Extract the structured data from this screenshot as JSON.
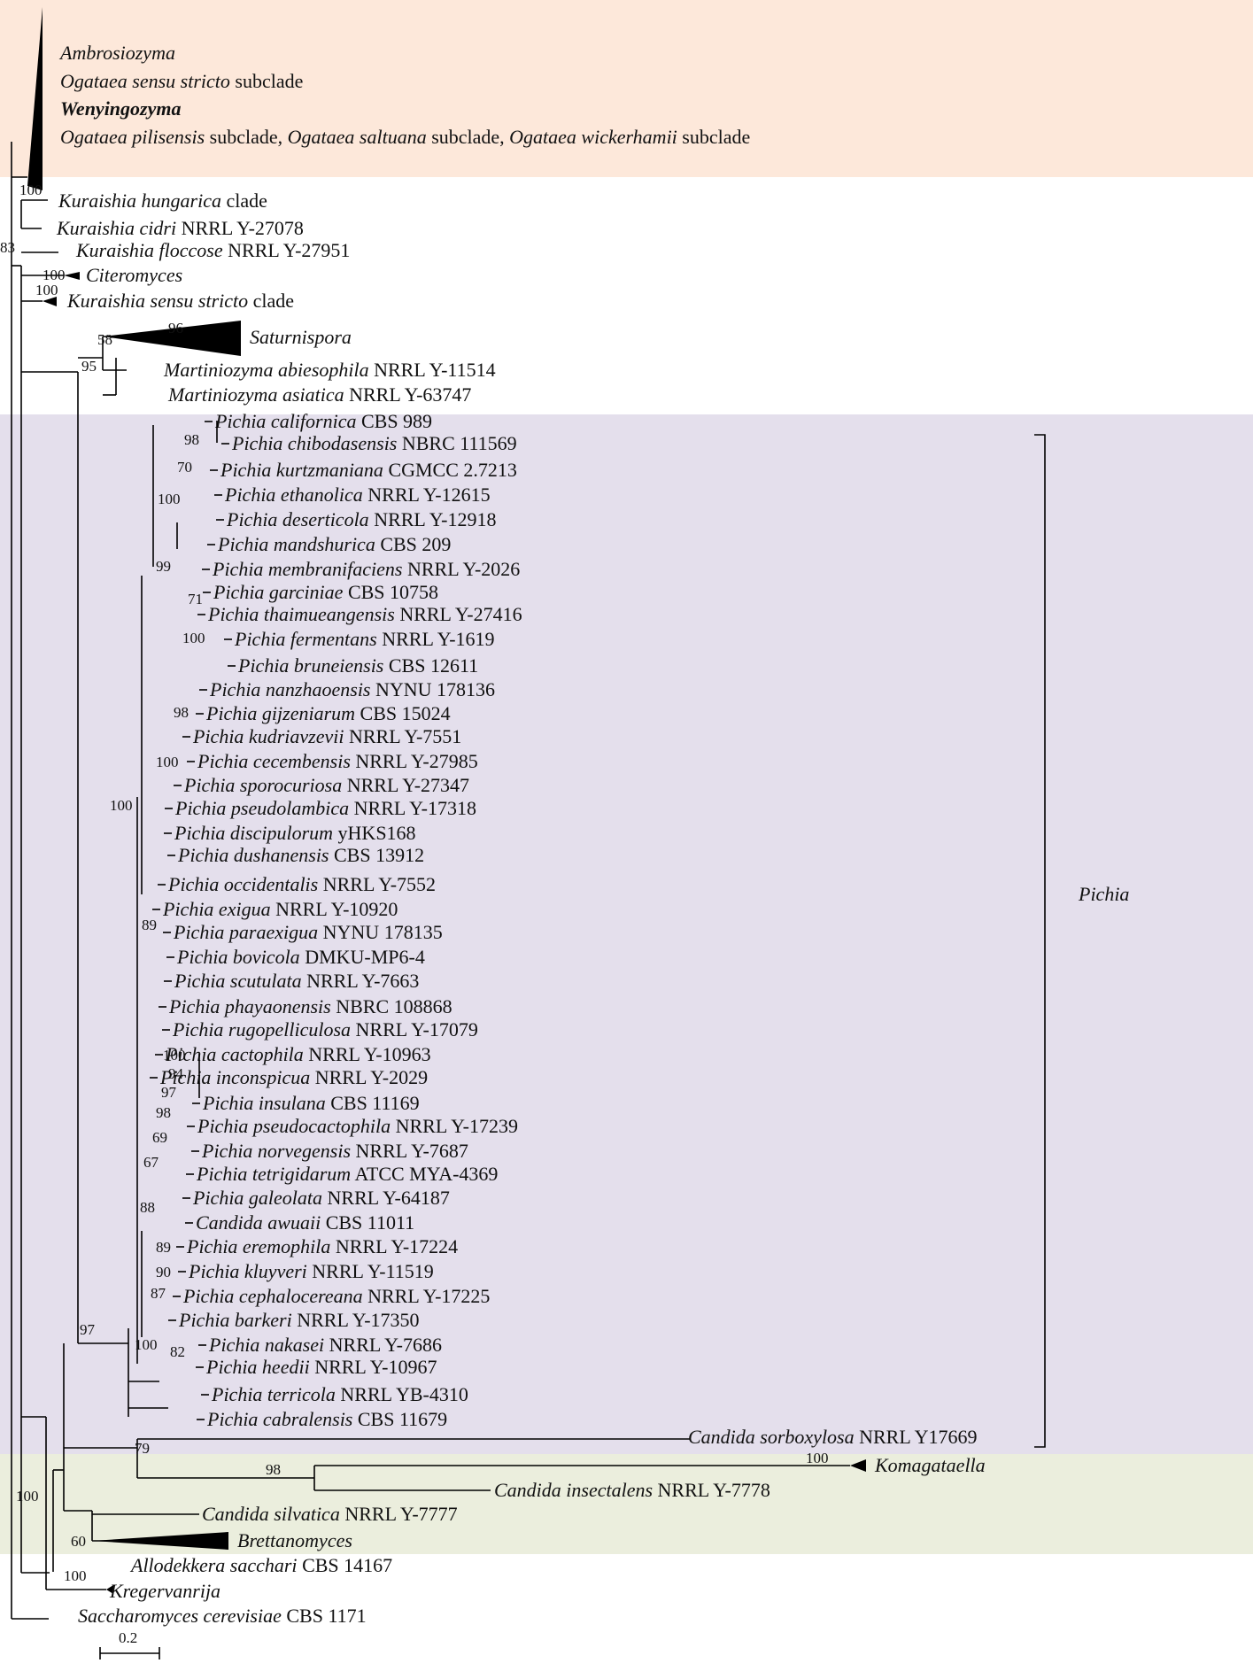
{
  "colors": {
    "band_top": "#fde8da",
    "band_mid": "#e4dfec",
    "band_bottom": "#ebeedd",
    "line": "#000000"
  },
  "header_clade": [
    [
      [
        "Ambrosiozyma",
        "i"
      ]
    ],
    [
      [
        "Ogataea sensu stricto",
        "i"
      ],
      [
        " subclade",
        "n"
      ]
    ],
    [
      [
        "Wenyingozyma",
        "ib"
      ]
    ],
    [
      [
        "Ogataea pilisensis",
        "i"
      ],
      [
        " subclade, ",
        "n"
      ],
      [
        "Ogataea saltuana",
        "i"
      ],
      [
        " subclade, ",
        "n"
      ],
      [
        "Ogataea wickerhamii",
        "i"
      ],
      [
        " subclade",
        "n"
      ]
    ]
  ],
  "tips": [
    [
      [
        "Kuraishia hungarica",
        "i"
      ],
      [
        " clade",
        "n"
      ]
    ],
    [
      [
        "Kuraishia cidri",
        "i"
      ],
      [
        " NRRL Y-27078",
        "n"
      ]
    ],
    [
      [
        "Kuraishia floccose",
        "i"
      ],
      [
        " NRRL Y-27951",
        "n"
      ]
    ],
    [
      [
        "Citeromyces",
        "i"
      ]
    ],
    [
      [
        "Kuraishia sensu stricto",
        "i"
      ],
      [
        " clade",
        "n"
      ]
    ],
    [
      [
        "Saturnispora",
        "i"
      ]
    ],
    [
      [
        "Martiniozyma abiesophila",
        "i"
      ],
      [
        " NRRL Y-11514",
        "n"
      ]
    ],
    [
      [
        "Martiniozyma asiatica",
        "i"
      ],
      [
        " NRRL Y-63747",
        "n"
      ]
    ],
    [
      [
        "Pichia californica",
        "i"
      ],
      [
        " CBS 989",
        "n"
      ]
    ],
    [
      [
        "Pichia chibodasensis",
        "i"
      ],
      [
        " NBRC 111569",
        "n"
      ]
    ],
    [
      [
        "Pichia kurtzmaniana",
        "i"
      ],
      [
        " CGMCC 2.7213",
        "n"
      ]
    ],
    [
      [
        "Pichia ethanolica",
        "i"
      ],
      [
        " NRRL Y-12615",
        "n"
      ]
    ],
    [
      [
        "Pichia deserticola",
        "i"
      ],
      [
        " NRRL Y-12918",
        "n"
      ]
    ],
    [
      [
        "Pichia mandshurica",
        "i"
      ],
      [
        " CBS 209",
        "n"
      ]
    ],
    [
      [
        "Pichia membranifaciens",
        "i"
      ],
      [
        " NRRL Y-2026",
        "n"
      ]
    ],
    [
      [
        "Pichia garciniae",
        "i"
      ],
      [
        " CBS 10758",
        "n"
      ]
    ],
    [
      [
        "Pichia thaimueangensis",
        "i"
      ],
      [
        " NRRL Y-27416",
        "n"
      ]
    ],
    [
      [
        "Pichia fermentans",
        "i"
      ],
      [
        " NRRL Y-1619",
        "n"
      ]
    ],
    [
      [
        "Pichia bruneiensis",
        "i"
      ],
      [
        " CBS 12611",
        "n"
      ]
    ],
    [
      [
        "Pichia nanzhaoensis",
        "i"
      ],
      [
        " NYNU 178136",
        "n"
      ]
    ],
    [
      [
        "Pichia gijzeniarum",
        "i"
      ],
      [
        " CBS 15024",
        "n"
      ]
    ],
    [
      [
        "Pichia kudriavzevii",
        "i"
      ],
      [
        " NRRL Y-7551",
        "n"
      ]
    ],
    [
      [
        "Pichia cecembensis",
        "i"
      ],
      [
        " NRRL Y-27985",
        "n"
      ]
    ],
    [
      [
        "Pichia sporocuriosa",
        "i"
      ],
      [
        " NRRL Y-27347",
        "n"
      ]
    ],
    [
      [
        "Pichia pseudolambica",
        "i"
      ],
      [
        " NRRL Y-17318",
        "n"
      ]
    ],
    [
      [
        "Pichia discipulorum",
        "i"
      ],
      [
        " yHKS168",
        "n"
      ]
    ],
    [
      [
        "Pichia dushanensis",
        "i"
      ],
      [
        " CBS 13912",
        "n"
      ]
    ],
    [
      [
        "Pichia occidentalis",
        "i"
      ],
      [
        " NRRL Y-7552",
        "n"
      ]
    ],
    [
      [
        "Pichia exigua",
        "i"
      ],
      [
        " NRRL Y-10920",
        "n"
      ]
    ],
    [
      [
        "Pichia paraexigua",
        "i"
      ],
      [
        " NYNU 178135",
        "n"
      ]
    ],
    [
      [
        "Pichia bovicola",
        "i"
      ],
      [
        " DMKU-MP6-4",
        "n"
      ]
    ],
    [
      [
        "Pichia scutulata",
        "i"
      ],
      [
        " NRRL Y-7663",
        "n"
      ]
    ],
    [
      [
        "Pichia phayaonensis",
        "i"
      ],
      [
        " NBRC 108868",
        "n"
      ]
    ],
    [
      [
        "Pichia rugopelliculosa",
        "i"
      ],
      [
        " NRRL Y-17079",
        "n"
      ]
    ],
    [
      [
        "Pichia cactophila",
        "i"
      ],
      [
        " NRRL Y-10963",
        "n"
      ]
    ],
    [
      [
        "Pichia inconspicua",
        "i"
      ],
      [
        " NRRL Y-2029",
        "n"
      ]
    ],
    [
      [
        "Pichia insulana",
        "i"
      ],
      [
        " CBS 11169",
        "n"
      ]
    ],
    [
      [
        "Pichia pseudocactophila",
        "i"
      ],
      [
        " NRRL Y-17239",
        "n"
      ]
    ],
    [
      [
        "Pichia norvegensis",
        "i"
      ],
      [
        " NRRL Y-7687",
        "n"
      ]
    ],
    [
      [
        "Pichia tetrigidarum",
        "i"
      ],
      [
        " ATCC MYA-4369",
        "n"
      ]
    ],
    [
      [
        "Pichia galeolata",
        "i"
      ],
      [
        " NRRL Y-64187",
        "n"
      ]
    ],
    [
      [
        "Candida awuaii",
        "i"
      ],
      [
        " CBS 11011",
        "n"
      ]
    ],
    [
      [
        "Pichia eremophila",
        "i"
      ],
      [
        " NRRL Y-17224",
        "n"
      ]
    ],
    [
      [
        "Pichia kluyveri",
        "i"
      ],
      [
        " NRRL Y-11519",
        "n"
      ]
    ],
    [
      [
        "Pichia cephalocereana",
        "i"
      ],
      [
        " NRRL Y-17225",
        "n"
      ]
    ],
    [
      [
        "Pichia barkeri",
        "i"
      ],
      [
        " NRRL Y-17350",
        "n"
      ]
    ],
    [
      [
        "Pichia nakasei",
        "i"
      ],
      [
        " NRRL Y-7686",
        "n"
      ]
    ],
    [
      [
        "Pichia heedii",
        "i"
      ],
      [
        " NRRL Y-10967",
        "n"
      ]
    ],
    [
      [
        "Pichia terricola",
        "i"
      ],
      [
        " NRRL YB-4310",
        "n"
      ]
    ],
    [
      [
        "Pichia cabralensis",
        "i"
      ],
      [
        " CBS 11679",
        "n"
      ]
    ],
    [
      [
        "Candida sorboxylosa",
        "i"
      ],
      [
        " NRRL Y17669",
        "n"
      ]
    ],
    [
      [
        "Komagataella",
        "i"
      ]
    ],
    [
      [
        "Candida insectalens",
        "i"
      ],
      [
        " NRRL Y-7778",
        "n"
      ]
    ],
    [
      [
        "Candida silvatica",
        "i"
      ],
      [
        " NRRL Y-7777",
        "n"
      ]
    ],
    [
      [
        "Brettanomyces",
        "i"
      ]
    ],
    [
      [
        "Allodekkera sacchari",
        "i"
      ],
      [
        " CBS 14167",
        "n"
      ]
    ],
    [
      [
        "Kregervanrija",
        "i"
      ]
    ],
    [
      [
        "Saccharomyces cerevisiae",
        "i"
      ],
      [
        " CBS 1171",
        "n"
      ]
    ]
  ],
  "supports": [
    "100",
    "83",
    "100",
    "100",
    "58",
    "96",
    "95",
    "98",
    "70",
    "100",
    "99",
    "71",
    "100",
    "98",
    "100",
    "100",
    "89",
    "100",
    "94",
    "97",
    "98",
    "69",
    "67",
    "88",
    "89",
    "90",
    "87",
    "100",
    "82",
    "97",
    "79",
    "98",
    "100",
    "100",
    "60",
    "100"
  ],
  "bracket_label": "Pichia",
  "scale_bar": {
    "label": "0.2"
  }
}
